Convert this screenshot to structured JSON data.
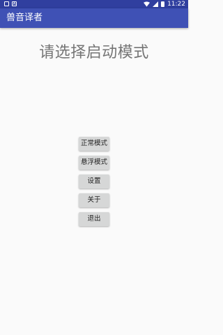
{
  "status_bar": {
    "time": "11:22",
    "left_icons": [
      "image-icon",
      "a-icon"
    ],
    "right_icons": [
      "wifi-icon",
      "cell-signal-icon",
      "battery-icon"
    ]
  },
  "app_bar": {
    "title": "兽音译者",
    "color": "#3f51b5",
    "status_color": "#303f9f"
  },
  "main": {
    "headline": "请选择启动模式",
    "buttons": [
      {
        "label": "正常模式"
      },
      {
        "label": "悬浮模式"
      },
      {
        "label": "设置"
      },
      {
        "label": "关于"
      },
      {
        "label": "退出"
      }
    ]
  }
}
